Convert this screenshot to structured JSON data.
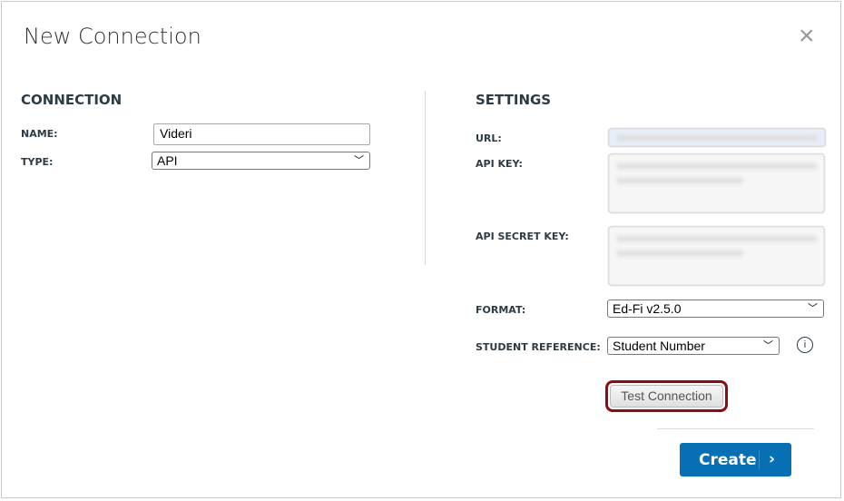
{
  "dialog": {
    "title": "New Connection",
    "close": "×"
  },
  "connection": {
    "heading": "CONNECTION",
    "name_label": "NAME:",
    "name_value": "Videri",
    "type_label": "TYPE:",
    "type_value": "API"
  },
  "settings": {
    "heading": "SETTINGS",
    "url_label": "URL:",
    "api_key_label": "API KEY:",
    "api_secret_label": "API SECRET KEY:",
    "format_label": "FORMAT:",
    "format_value": "Ed-Fi v2.5.0",
    "student_ref_label": "STUDENT REFERENCE:",
    "student_ref_value": "Student Number",
    "info": "i"
  },
  "buttons": {
    "test": "Test Connection",
    "create": "Create",
    "create_arrow": "›"
  }
}
